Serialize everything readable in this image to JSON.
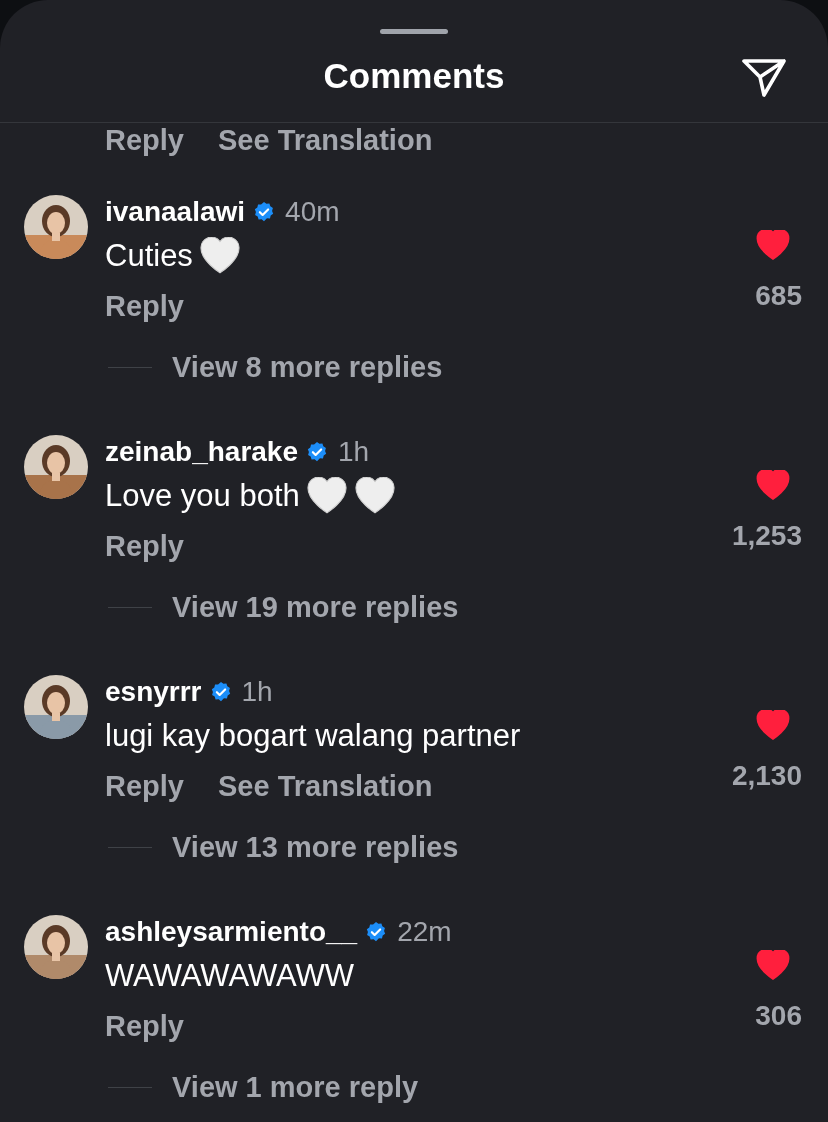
{
  "header": {
    "title": "Comments"
  },
  "cut_actions": [
    "Reply",
    "See Translation"
  ],
  "comments": [
    {
      "username": "ivanaalawi",
      "verified": true,
      "time": "40m",
      "text": "Cuties",
      "emojis": [
        {
          "kind": "white_heart"
        }
      ],
      "liked": true,
      "likes": "685",
      "actions": [
        "Reply"
      ],
      "view_replies": "View 8 more replies",
      "avatar": {
        "kind": "picture"
      }
    },
    {
      "username": "zeinab_harake",
      "verified": true,
      "time": "1h",
      "text": "Love you both",
      "emojis": [
        {
          "kind": "white_heart"
        },
        {
          "kind": "white_heart"
        }
      ],
      "liked": true,
      "likes": "1,253",
      "actions": [
        "Reply"
      ],
      "view_replies": "View 19 more replies",
      "avatar": {
        "kind": "picture"
      }
    },
    {
      "username": "esnyrrr",
      "verified": true,
      "time": "1h",
      "text": "lugi kay bogart walang partner",
      "liked": true,
      "likes": "2,130",
      "actions": [
        "Reply",
        "See Translation"
      ],
      "view_replies": "View 13 more replies",
      "avatar": {
        "kind": "picture"
      }
    },
    {
      "username": "ashleysarmiento__",
      "verified": true,
      "time": "22m",
      "text": "WAWAWAWAWW",
      "liked": true,
      "likes": "306",
      "actions": [
        "Reply"
      ],
      "view_replies": "View 1 more reply",
      "avatar": {
        "kind": "picture"
      }
    }
  ]
}
